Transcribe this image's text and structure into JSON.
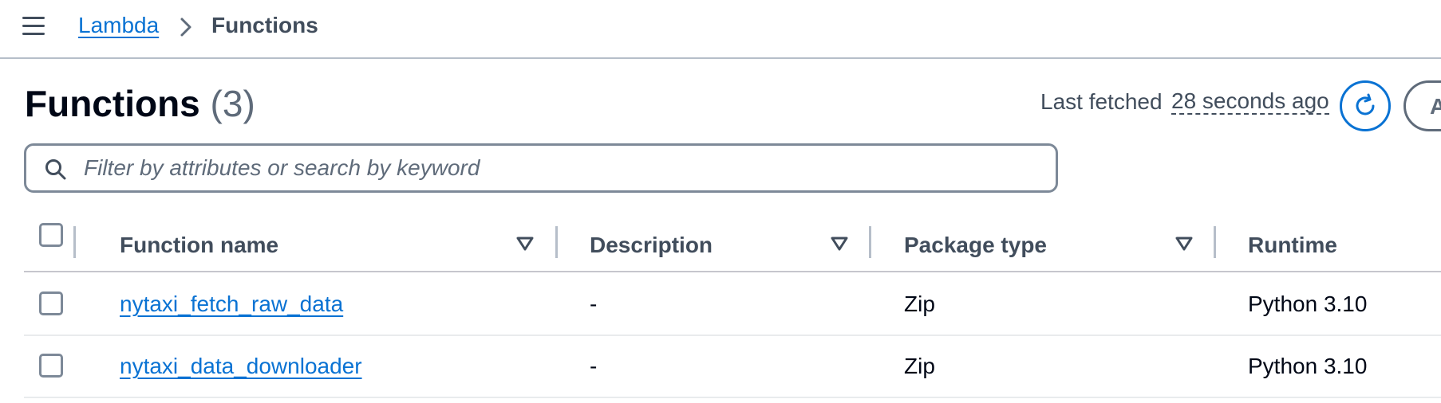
{
  "breadcrumb": {
    "parent": "Lambda",
    "current": "Functions"
  },
  "page": {
    "title": "Functions",
    "count": "(3)"
  },
  "fetch_status": {
    "label": "Last fetched",
    "value": "28 seconds ago"
  },
  "next_button": {
    "label": "A"
  },
  "search": {
    "placeholder": "Filter by attributes or search by keyword",
    "value": ""
  },
  "table": {
    "columns": [
      "Function name",
      "Description",
      "Package type",
      "Runtime"
    ],
    "rows": [
      {
        "name": "nytaxi_fetch_raw_data",
        "description": "-",
        "package_type": "Zip",
        "runtime": "Python 3.10"
      },
      {
        "name": "nytaxi_data_downloader",
        "description": "-",
        "package_type": "Zip",
        "runtime": "Python 3.10"
      }
    ]
  },
  "icons": [
    "menu-icon",
    "chevron-right-icon",
    "refresh-icon",
    "search-icon",
    "sort-down-icon"
  ],
  "colors": {
    "link": "#0972d3",
    "text": "#000716",
    "secondary": "#414d5c",
    "border": "#7d8998"
  }
}
